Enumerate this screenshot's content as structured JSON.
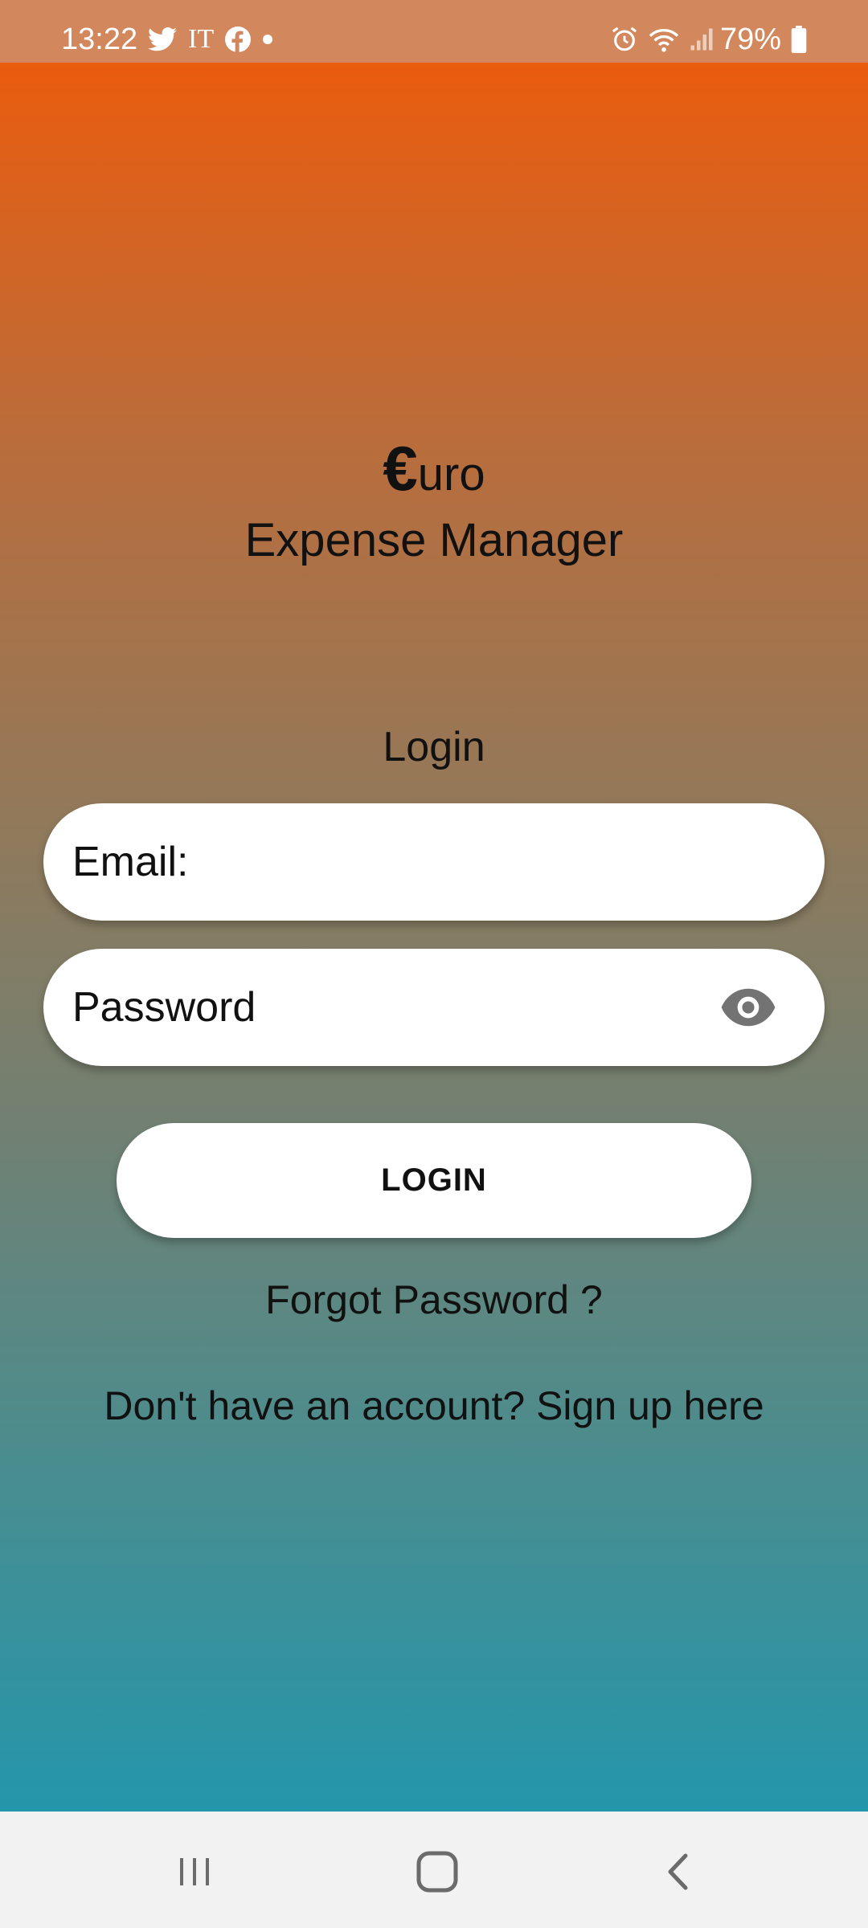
{
  "status_bar": {
    "time": "13:22",
    "carrier_label": "IT",
    "battery": "79%",
    "icons": [
      "twitter-icon",
      "facebook-icon",
      "dot-icon",
      "alarm-icon",
      "wifi-icon",
      "signal-icon",
      "battery-icon"
    ]
  },
  "app": {
    "logo_symbol": "€",
    "logo_suffix": "uro",
    "subtitle": "Expense Manager"
  },
  "login": {
    "heading": "Login",
    "email_placeholder": "Email:",
    "password_placeholder": "Password",
    "button_label": "LOGIN",
    "forgot_password": "Forgot Password ?",
    "signup_prompt": "Don't have an account?",
    "signup_link": "Sign up here"
  },
  "navigation": {
    "buttons": [
      "recents-icon",
      "home-icon",
      "back-icon"
    ]
  },
  "colors": {
    "status_bar": "#d3875c",
    "gradient_top": "#ea5c0e",
    "gradient_bottom": "#2496ab",
    "field_background": "#ffffff",
    "text": "#111111"
  }
}
